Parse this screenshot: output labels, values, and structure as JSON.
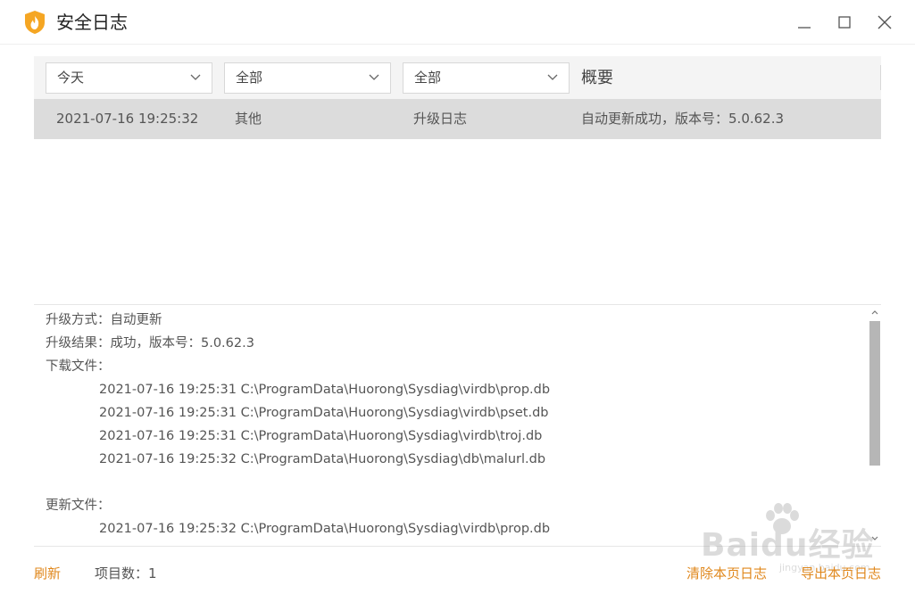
{
  "window": {
    "title": "安全日志",
    "accent_color": "#f5a623",
    "link_color": "#e0881d"
  },
  "filters": {
    "time": "今天",
    "category": "全部",
    "type": "全部",
    "summary_header": "概要"
  },
  "log_rows": [
    {
      "time": "2021-07-16 19:25:32",
      "category": "其他",
      "type": "升级日志",
      "summary": "自动更新成功，版本号：5.0.62.3"
    }
  ],
  "details": {
    "method": "升级方式：自动更新",
    "result": "升级结果：成功，版本号：5.0.62.3",
    "download_header": "下载文件：",
    "download_files": [
      "2021-07-16 19:25:31 C:\\ProgramData\\Huorong\\Sysdiag\\virdb\\prop.db",
      "2021-07-16 19:25:31 C:\\ProgramData\\Huorong\\Sysdiag\\virdb\\pset.db",
      "2021-07-16 19:25:31 C:\\ProgramData\\Huorong\\Sysdiag\\virdb\\troj.db",
      "2021-07-16 19:25:32 C:\\ProgramData\\Huorong\\Sysdiag\\db\\malurl.db"
    ],
    "update_header": "更新文件：",
    "update_files": [
      "2021-07-16 19:25:32 C:\\ProgramData\\Huorong\\Sysdiag\\virdb\\prop.db"
    ]
  },
  "footer": {
    "refresh": "刷新",
    "item_count": "项目数：1",
    "clear_page": "清除本页日志",
    "export_page": "导出本页日志"
  },
  "watermark": {
    "text": "Baidu经验",
    "sub": "jingyan.baidu.com"
  }
}
